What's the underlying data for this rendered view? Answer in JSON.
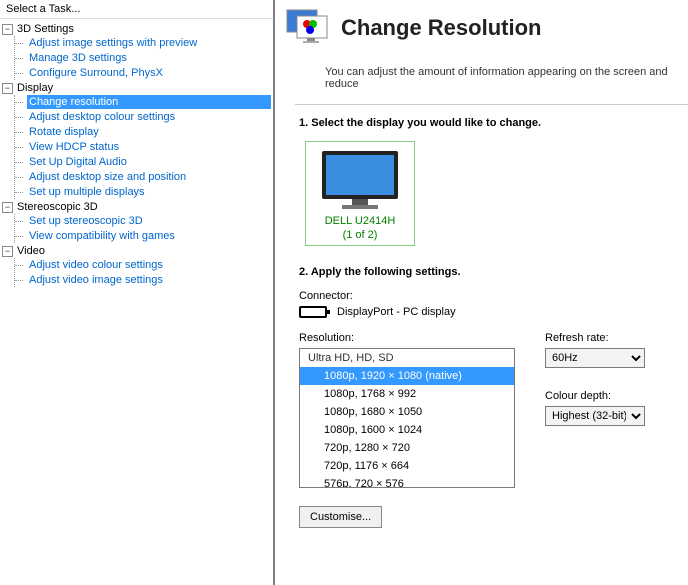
{
  "sidebar": {
    "header": "Select a Task...",
    "groups": [
      {
        "label": "3D Settings",
        "items": [
          "Adjust image settings with preview",
          "Manage 3D settings",
          "Configure Surround, PhysX"
        ]
      },
      {
        "label": "Display",
        "items": [
          "Change resolution",
          "Adjust desktop colour settings",
          "Rotate display",
          "View HDCP status",
          "Set Up Digital Audio",
          "Adjust desktop size and position",
          "Set up multiple displays"
        ]
      },
      {
        "label": "Stereoscopic 3D",
        "items": [
          "Set up stereoscopic 3D",
          "View compatibility with games"
        ]
      },
      {
        "label": "Video",
        "items": [
          "Adjust video colour settings",
          "Adjust video image settings"
        ]
      }
    ]
  },
  "content": {
    "title": "Change Resolution",
    "description": "You can adjust the amount of information appearing on the screen and reduce",
    "step1": "1. Select the display you would like to change.",
    "monitor": {
      "name": "DELL U2414H",
      "index": "(1 of 2)"
    },
    "step2": "2. Apply the following settings.",
    "connector_label": "Connector:",
    "connector_value": "DisplayPort - PC display",
    "resolution_label": "Resolution:",
    "refresh_label": "Refresh rate:",
    "refresh_value": "60Hz",
    "depth_label": "Colour depth:",
    "depth_value": "Highest (32-bit)",
    "customise": "Customise...",
    "list": {
      "group": "Ultra HD, HD, SD",
      "items": [
        "1080p, 1920 × 1080 (native)",
        "1080p, 1768 × 992",
        "1080p, 1680 × 1050",
        "1080p, 1600 × 1024",
        "720p, 1280 × 720",
        "720p, 1176 × 664",
        "576p, 720 × 576"
      ]
    }
  }
}
